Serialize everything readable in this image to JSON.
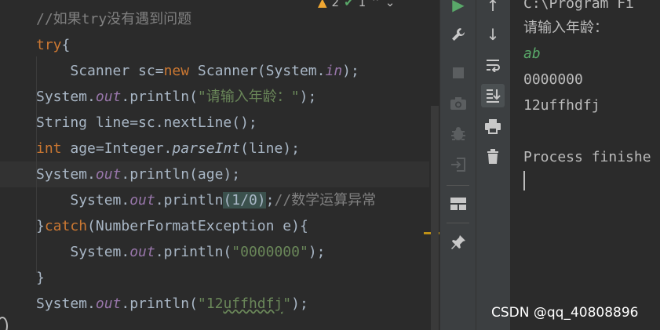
{
  "editor": {
    "inspections": {
      "warning_count": "2",
      "ok_count": "1"
    },
    "lines": {
      "comment1": "//如果try没有遇到问题",
      "try_kw": "try",
      "try_brace": "{",
      "l3_indent": "    ",
      "l3_type": "Scanner sc=",
      "l3_new": "new",
      "l3_rest": " Scanner(System.",
      "l3_field": "in",
      "l3_end": ");",
      "l4_a": "System.",
      "l4_field": "out",
      "l4_b": ".println(",
      "l4_str": "\"请输入年龄：\"",
      "l4_end": ");",
      "l5": "String line=sc.nextLine();",
      "l6_kw": "int",
      "l6_a": " age=Integer.",
      "l6_m": "parseInt",
      "l6_end": "(line);",
      "l7_a": "System.",
      "l7_field": "out",
      "l7_end": ".println(age);",
      "l8_indent": "    ",
      "l8_a": "System.",
      "l8_field": "out",
      "l8_b": ".println",
      "l8_p1": "(",
      "l8_args": "1/0",
      "l8_p2": ")",
      "l8_semi": ";",
      "l8_cmt": "//数学运算异常",
      "l9_brace": "}",
      "l9_kw": "catch",
      "l9_rest": "(NumberFormatException e){",
      "l10_indent": "    ",
      "l10_a": "System.",
      "l10_field": "out",
      "l10_b": ".println(",
      "l10_str": "\"0000000\"",
      "l10_end": ");",
      "l11": "}",
      "l12_a": "System.",
      "l12_field": "out",
      "l12_b": ".println(",
      "l12_str_open": "\"12",
      "l12_str_typo": "uffhdfj",
      "l12_str_close": "\"",
      "l12_end": ");"
    }
  },
  "console": {
    "header": "C:\\Program Fi",
    "prompt": "请输入年龄：",
    "input": "ab",
    "out1": "0000000",
    "out2": "12uffhdfj",
    "finish": "Process finishe"
  },
  "watermark": "CSDN @qq_40808896",
  "colors": {
    "keyword": "#cc7832",
    "field": "#9876aa",
    "string": "#6a8759",
    "comment": "#808080",
    "run_green": "#59a869"
  }
}
